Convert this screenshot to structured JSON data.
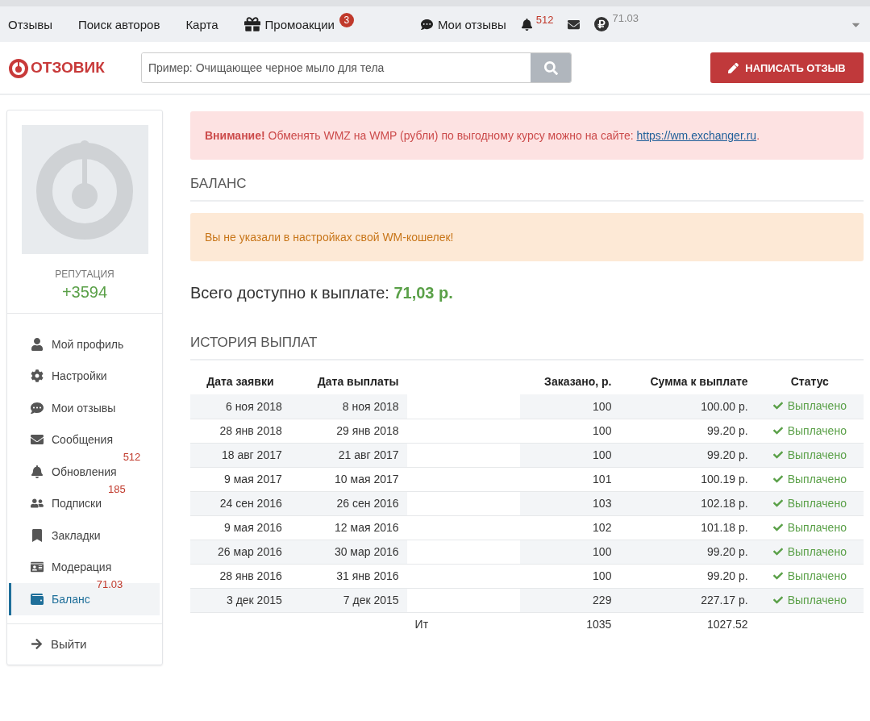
{
  "top_nav": {
    "links": [
      {
        "label": "Отзывы"
      },
      {
        "label": "Поиск авторов"
      },
      {
        "label": "Карта"
      },
      {
        "label": "Промоакции",
        "badge": "3"
      }
    ],
    "user_links": {
      "my_reviews": "Мои отзывы",
      "notifications": "512",
      "balance": "71.03"
    }
  },
  "header": {
    "logo": "ОТЗОВИК",
    "search": {
      "placeholder": "Пример: Очищающее черное мыло для тела"
    },
    "write_button": "НАПИСАТЬ ОТЗЫВ"
  },
  "sidebar": {
    "reputation_label": "РЕПУТАЦИЯ",
    "reputation": "+3594",
    "items": [
      {
        "label": "Мой профиль",
        "selected": false
      },
      {
        "label": "Настройки",
        "selected": false
      },
      {
        "label": "Мои отзывы",
        "selected": false
      },
      {
        "label": "Сообщения",
        "selected": false
      },
      {
        "label": "Обновления",
        "badge": "512",
        "selected": false
      },
      {
        "label": "Подписки",
        "badge": "185",
        "selected": false
      },
      {
        "label": "Закладки",
        "selected": false
      },
      {
        "label": "Модерация",
        "selected": false
      },
      {
        "label": "Баланс",
        "badge": "71.03",
        "selected": true
      }
    ],
    "logout": "Выйти"
  },
  "alert": {
    "text": "**Внимание!** Обменять WMZ на WMP (рубли) по выгодному курсу можно на сайте: ",
    "link": "https://wm.exchanger.ru",
    "end": "."
  },
  "balance_heading": "БАЛАНС",
  "warning": "Вы не указали в настройках свой WM-кошелек!",
  "available": {
    "label": "Всего доступно к выплате:",
    "amount": "71,03 р."
  },
  "history_heading": "ИСТОРИЯ ВЫПЛАТ",
  "table": {
    "columns": [
      "Дата заявки",
      "Дата выплаты",
      null,
      "Заказано, р.",
      "Сумма к выплате",
      "Статус"
    ],
    "rows": [
      {
        "requested": "6 ноя 2018",
        "paid": "8 ноя 2018",
        "ordered": "100",
        "amount": "100.00 р.",
        "status": "Выплачено"
      },
      {
        "requested": "28 янв 2018",
        "paid": "29 янв 2018",
        "ordered": "100",
        "amount": "99.20 р.",
        "status": "Выплачено"
      },
      {
        "requested": "18 авг 2017",
        "paid": "21 авг 2017",
        "ordered": "100",
        "amount": "99.20 р.",
        "status": "Выплачено"
      },
      {
        "requested": "9 мая 2017",
        "paid": "10 мая 2017",
        "ordered": "101",
        "amount": "100.19 р.",
        "status": "Выплачено"
      },
      {
        "requested": "24 сен 2016",
        "paid": "26 сен 2016",
        "ordered": "103",
        "amount": "102.18 р.",
        "status": "Выплачено"
      },
      {
        "requested": "9 мая 2016",
        "paid": "12 мая 2016",
        "ordered": "102",
        "amount": "101.18 р.",
        "status": "Выплачено"
      },
      {
        "requested": "26 мар 2016",
        "paid": "30 мар 2016",
        "ordered": "100",
        "amount": "99.20 р.",
        "status": "Выплачено"
      },
      {
        "requested": "28 янв 2016",
        "paid": "31 янв 2016",
        "ordered": "100",
        "amount": "99.20 р.",
        "status": "Выплачено"
      },
      {
        "requested": "3 дек 2015",
        "paid": "7 дек 2015",
        "ordered": "229",
        "amount": "227.17 р.",
        "status": "Выплачено"
      }
    ],
    "total": {
      "label": "Ит",
      "ordered": "1035",
      "amount": "1027.52"
    }
  }
}
